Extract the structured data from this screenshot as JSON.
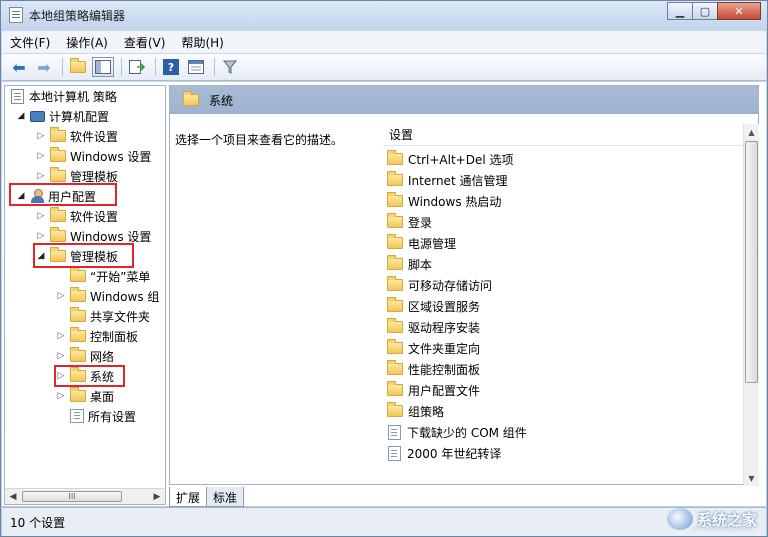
{
  "window": {
    "title": "本地组策略编辑器"
  },
  "menu": [
    "文件(F)",
    "操作(A)",
    "查看(V)",
    "帮助(H)"
  ],
  "toolbar": {
    "icons": [
      "back-arrow-icon",
      "forward-arrow-icon",
      "up-folder-icon",
      "show-hide-tree-icon",
      "export-list-icon",
      "help-icon",
      "properties-icon",
      "filter-icon"
    ]
  },
  "tree": {
    "root": "本地计算机 策略",
    "computer_config": "计算机配置",
    "computer_children": [
      "软件设置",
      "Windows 设置",
      "管理模板"
    ],
    "user_config": "用户配置",
    "user_children": [
      "软件设置",
      "Windows 设置",
      "管理模板"
    ],
    "admin_children": [
      "“开始”菜单",
      "Windows 组",
      "共享文件夹",
      "控制面板",
      "网络",
      "系统",
      "桌面",
      "所有设置"
    ]
  },
  "right": {
    "header_title": "系统",
    "description": "选择一个项目来查看它的描述。",
    "column_header": "设置",
    "folders": [
      "Ctrl+Alt+Del 选项",
      "Internet 通信管理",
      "Windows 热启动",
      "登录",
      "电源管理",
      "脚本",
      "可移动存储访问",
      "区域设置服务",
      "驱动程序安装",
      "文件夹重定向",
      "性能控制面板",
      "用户配置文件",
      "组策略"
    ],
    "settings": [
      "下载缺少的 COM 组件",
      "2000 年世纪转译"
    ]
  },
  "tabs": [
    "扩展",
    "标准"
  ],
  "status": "10 个设置",
  "watermark": {
    "text": "系统之家",
    "sub": "XITONGZHIJIA.NET"
  },
  "highlight_color": "#e0262b"
}
